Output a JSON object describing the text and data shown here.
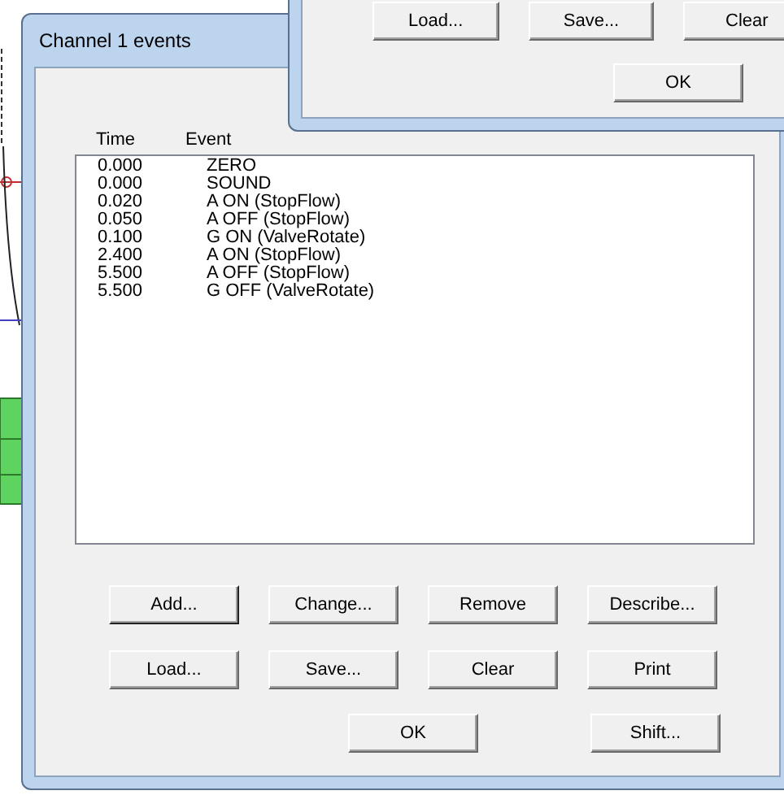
{
  "events_dialog": {
    "title": "Channel 1 events",
    "columns": [
      "Time",
      "Event"
    ],
    "rows": [
      {
        "time": "0.000",
        "event": "ZERO"
      },
      {
        "time": "0.000",
        "event": "SOUND"
      },
      {
        "time": "0.020",
        "event": "A ON (StopFlow)"
      },
      {
        "time": "0.050",
        "event": "A OFF (StopFlow)"
      },
      {
        "time": "0.100",
        "event": "G ON (ValveRotate)"
      },
      {
        "time": "2.400",
        "event": "A ON (StopFlow)"
      },
      {
        "time": "5.500",
        "event": "A OFF (StopFlow)"
      },
      {
        "time": "5.500",
        "event": "G OFF (ValveRotate)"
      }
    ],
    "button_rows": [
      [
        {
          "label": "Add...",
          "default": true
        },
        {
          "label": "Change...",
          "default": false
        },
        {
          "label": "Remove",
          "default": false
        },
        {
          "label": "Describe...",
          "default": false
        }
      ],
      [
        {
          "label": "Load...",
          "default": false
        },
        {
          "label": "Save...",
          "default": false
        },
        {
          "label": "Clear",
          "default": false
        },
        {
          "label": "Print",
          "default": false
        }
      ]
    ],
    "ok_button": "OK",
    "shift_button": "Shift..."
  },
  "other_dialog": {
    "buttons": [
      {
        "label": "Load..."
      },
      {
        "label": "Save..."
      },
      {
        "label": "Clear"
      }
    ],
    "ok_button": "OK"
  }
}
